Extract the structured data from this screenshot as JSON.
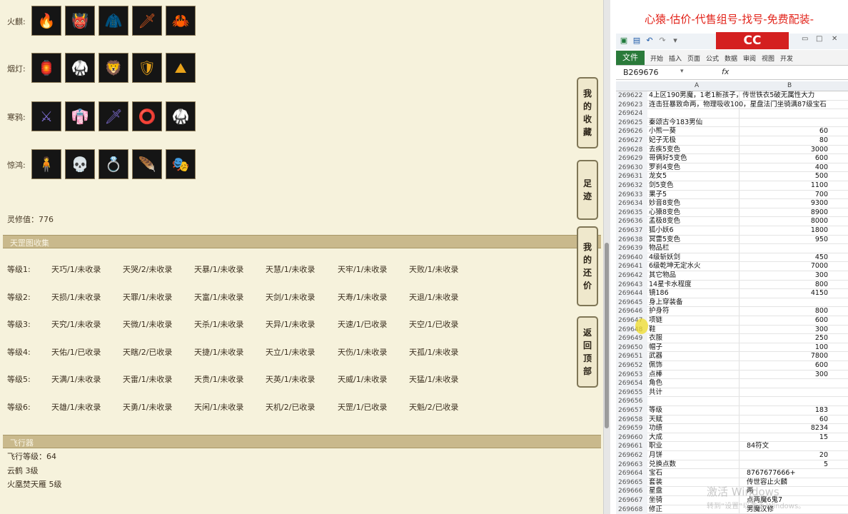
{
  "artifacts": {
    "rows": [
      {
        "label": "火麒:",
        "icons": [
          "fire-weapon-icon",
          "demon-mask-icon",
          "robe-icon",
          "blade-icon",
          "claw-icon"
        ]
      },
      {
        "label": "烟灯:",
        "icons": [
          "lantern-icon",
          "golden-armor-icon",
          "golden-head-icon",
          "amber-shield-icon",
          "mountain-icon"
        ]
      },
      {
        "label": "寒鸦:",
        "icons": [
          "purple-weapon-icon",
          "purple-robe-icon",
          "ice-sword-icon",
          "frost-ring-icon",
          "dark-armor-icon"
        ]
      },
      {
        "label": "惊鸿:",
        "icons": [
          "jade-figure-icon",
          "skull-icon",
          "silver-ring-icon",
          "feather-icon",
          "green-mask-icon"
        ]
      }
    ],
    "lingxiu": "灵修值：776"
  },
  "tiangang": {
    "title": "天罡图收集",
    "rows": [
      {
        "grade": "等级1:",
        "cells": [
          "天巧/1/未收录",
          "天哭/2/未收录",
          "天暴/1/未收录",
          "天慧/1/未收录",
          "天牢/1/未收录",
          "天败/1/未收录"
        ]
      },
      {
        "grade": "等级2:",
        "cells": [
          "天损/1/未收录",
          "天罪/1/未收录",
          "天富/1/未收录",
          "天剑/1/未收录",
          "天寿/1/未收录",
          "天退/1/未收录"
        ]
      },
      {
        "grade": "等级3:",
        "cells": [
          "天究/1/未收录",
          "天微/1/未收录",
          "天杀/1/未收录",
          "天异/1/未收录",
          "天速/1/已收录",
          "天空/1/已收录"
        ]
      },
      {
        "grade": "等级4:",
        "cells": [
          "天佑/1/已收录",
          "天瞎/2/已收录",
          "天捷/1/未收录",
          "天立/1/未收录",
          "天伤/1/未收录",
          "天孤/1/未收录"
        ]
      },
      {
        "grade": "等级5:",
        "cells": [
          "天满/1/未收录",
          "天雷/1/未收录",
          "天贵/1/未收录",
          "天英/1/未收录",
          "天威/1/未收录",
          "天猛/1/未收录"
        ]
      },
      {
        "grade": "等级6:",
        "cells": [
          "天雄/1/未收录",
          "天勇/1/未收录",
          "天闲/1/未收录",
          "天机/2/已收录",
          "天罡/1/已收录",
          "天魁/2/已收录"
        ]
      }
    ]
  },
  "flight": {
    "title": "飞行器",
    "level": "飞行等级：64",
    "yunhe": "云鹤   3级",
    "huofeng": "火凰焚天雁   5级"
  },
  "side_buttons": [
    {
      "chars": [
        "我",
        "的",
        "收",
        "藏"
      ]
    },
    {
      "chars": [
        "足",
        "迹"
      ]
    },
    {
      "chars": [
        "我",
        "的",
        "还",
        "价"
      ]
    },
    {
      "chars": [
        "返",
        "回",
        "顶",
        "部"
      ]
    }
  ],
  "excel": {
    "banner": "心猿-估价-代售组号-找号-免费配装-",
    "logo": "CC",
    "file_tab": "文件",
    "ribbon_tabs": [
      "开始",
      "插入",
      "页面",
      "公式",
      "数据",
      "审阅",
      "视图",
      "开发"
    ],
    "name_box": "B269676",
    "fx": "fx",
    "col_a": "A",
    "col_b": "B",
    "rows": [
      {
        "n": "269622",
        "a": "4上区190男魔，1老1新孩子，传世铁衣5破无属性大力",
        "b": ""
      },
      {
        "n": "269623",
        "a": "连击狂暴致命两，物理吸收100，星盘法门坐骑满87级宝石",
        "b": ""
      },
      {
        "n": "269624",
        "a": "",
        "b": ""
      },
      {
        "n": "269625",
        "a": "秦颂古今183男仙",
        "b": ""
      },
      {
        "n": "269626",
        "a": "小熊一葵",
        "b": "60"
      },
      {
        "n": "269627",
        "a": "妃子无极",
        "b": "80"
      },
      {
        "n": "269628",
        "a": "去疾5变色",
        "b": "3000"
      },
      {
        "n": "269629",
        "a": "哥俩好5变色",
        "b": "600"
      },
      {
        "n": "269630",
        "a": "罗刹4变色",
        "b": "400"
      },
      {
        "n": "269631",
        "a": "龙女5",
        "b": "500"
      },
      {
        "n": "269632",
        "a": "剑5变色",
        "b": "1100"
      },
      {
        "n": "269633",
        "a": "果子5",
        "b": "700"
      },
      {
        "n": "269634",
        "a": "妙音8变色",
        "b": "9300"
      },
      {
        "n": "269635",
        "a": "心猿8变色",
        "b": "8900"
      },
      {
        "n": "269636",
        "a": "孟极8变色",
        "b": "8000"
      },
      {
        "n": "269637",
        "a": "狐小妖6",
        "b": "1800"
      },
      {
        "n": "269638",
        "a": "冥雷5变色",
        "b": "950"
      },
      {
        "n": "269639",
        "a": "物品栏",
        "b": ""
      },
      {
        "n": "269640",
        "a": "4级斩妖剑",
        "b": "450"
      },
      {
        "n": "269641",
        "a": "6级乾坤无定水火",
        "b": "7000"
      },
      {
        "n": "269642",
        "a": "其它物品",
        "b": "300"
      },
      {
        "n": "269643",
        "a": "14星卡水程度",
        "b": "800"
      },
      {
        "n": "269644",
        "a": "镜186",
        "b": "4150"
      },
      {
        "n": "269645",
        "a": "身上穿装备",
        "b": ""
      },
      {
        "n": "269646",
        "a": "护身符",
        "b": "800"
      },
      {
        "n": "269647",
        "a": "项链",
        "b": "600"
      },
      {
        "n": "269648",
        "a": "鞋",
        "b": "300"
      },
      {
        "n": "269649",
        "a": "衣服",
        "b": "250"
      },
      {
        "n": "269650",
        "a": "帽子",
        "b": "100"
      },
      {
        "n": "269651",
        "a": "武器",
        "b": "7800"
      },
      {
        "n": "269652",
        "a": "佩饰",
        "b": "600"
      },
      {
        "n": "269653",
        "a": "点棒",
        "b": "300"
      },
      {
        "n": "269654",
        "a": "角色",
        "b": ""
      },
      {
        "n": "269655",
        "a": "共计",
        "b": ""
      },
      {
        "n": "269656",
        "a": "",
        "b": ""
      },
      {
        "n": "269657",
        "a": "等级",
        "b": "183"
      },
      {
        "n": "269658",
        "a": "天赋",
        "b": "60"
      },
      {
        "n": "269659",
        "a": "功绩",
        "b": "8234"
      },
      {
        "n": "269660",
        "a": "大成",
        "b": "15"
      },
      {
        "n": "269661",
        "a": "职业",
        "b": "84符文",
        "bl": true
      },
      {
        "n": "269662",
        "a": "月饼",
        "b": "20"
      },
      {
        "n": "269663",
        "a": "兑换点数",
        "b": "5"
      },
      {
        "n": "269664",
        "a": "宝石",
        "b": "8767677666+",
        "bl": true
      },
      {
        "n": "269665",
        "a": "套装",
        "b": "传世容止火麟",
        "bl": true
      },
      {
        "n": "269666",
        "a": "星盘",
        "b": "两",
        "bl": true
      },
      {
        "n": "269667",
        "a": "坐骑",
        "b": "点两魔6鬼7",
        "bl": true
      },
      {
        "n": "269668",
        "a": "修正",
        "b": "男魔汉修",
        "bl": true
      }
    ],
    "watermark": "激活 Windows",
    "watermark_sub": "转到“设置”以激活 Windows。"
  }
}
